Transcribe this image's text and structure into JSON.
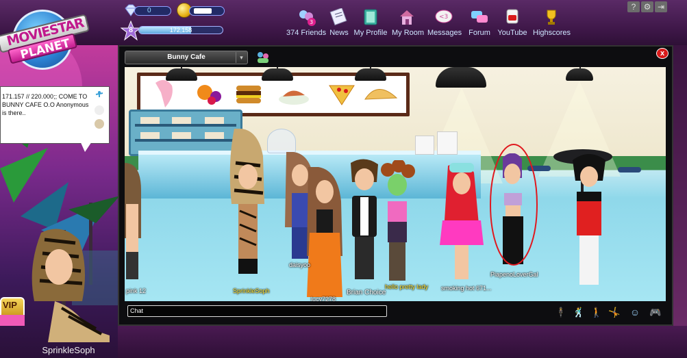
{
  "app": {
    "logo_line1": "MOVIESTAR",
    "logo_line2": "PLANET"
  },
  "stats": {
    "diamonds": "0",
    "level": "8",
    "fame_text": "172,158",
    "fame_fraction": 0.62
  },
  "nav": [
    {
      "label": "374 Friends",
      "icon": "friends-icon",
      "badge": "3"
    },
    {
      "label": "News",
      "icon": "news-icon"
    },
    {
      "label": "My Profile",
      "icon": "profile-icon"
    },
    {
      "label": "My Room",
      "icon": "house-icon"
    },
    {
      "label": "Messages",
      "icon": "messages-icon",
      "badge": "<3"
    },
    {
      "label": "Forum",
      "icon": "forum-icon"
    },
    {
      "label": "YouTube",
      "icon": "youtube-icon"
    },
    {
      "label": "Highscores",
      "icon": "trophy-icon"
    }
  ],
  "top_right": {
    "help": "?",
    "settings": "⚙",
    "exit": "⇥"
  },
  "bubble": {
    "text": "171.157 // 220.000;; COME TO BUNNY CAFE O.O Anonymous is there.."
  },
  "player": {
    "name": "SprinkleSoph",
    "vip": "VIP"
  },
  "room": {
    "title": "Bunny Cafe",
    "dropdown": "▾",
    "close": "x",
    "chat_placeholder": "Chat"
  },
  "characters": [
    {
      "name": "pink 12"
    },
    {
      "name": "SprinkleSoph"
    },
    {
      "name": "daisyoo"
    },
    {
      "name": "lucy7278"
    },
    {
      "name": "Brian Choice"
    },
    {
      "name": "hello pretty lady"
    },
    {
      "name": "smoking hot 671..."
    },
    {
      "name": "PiapenoLoverGal"
    }
  ],
  "colors": {
    "accent_pink": "#c0198c",
    "highlight_red": "#e0181e",
    "chat_bg": "#050505"
  }
}
